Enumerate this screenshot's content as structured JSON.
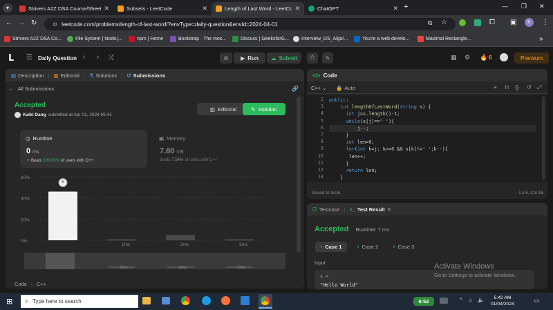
{
  "browser": {
    "tabs": [
      {
        "label": "Strivers A2Z DSA Course/Sheet",
        "active": false
      },
      {
        "label": "Subsets - LeetCode",
        "active": false
      },
      {
        "label": "Length of Last Word - LeetCode",
        "active": true
      },
      {
        "label": "ChatGPT",
        "active": false
      }
    ],
    "url": "leetcode.com/problems/length-of-last-word/?envType=daily-question&envId=2024-04-01",
    "profile_initial": "K",
    "bookmarks": [
      "Strivers A2Z DSA Co...",
      "File System | Node.j...",
      "npm | Home",
      "Bootstrap · The mos...",
      "Discuss | GeeksforG...",
      "Interview_DS_Algo/...",
      "You're a web develo...",
      "Maximal Rectangle..."
    ]
  },
  "header": {
    "title": "Daily Question",
    "run": "Run",
    "submit": "Submit",
    "streak": "6",
    "premium": "Premium"
  },
  "left": {
    "tabs": [
      "Description",
      "Editorial",
      "Solutions",
      "Submissions"
    ],
    "all_submissions": "All Submissions",
    "status": "Accepted",
    "user": "Kalki Dang",
    "submitted": "submitted at Apr 01, 2024 05:41",
    "editorial_btn": "Editorial",
    "solution_btn": "Solution",
    "runtime_label": "Runtime",
    "runtime_value": "0",
    "runtime_unit": "ms",
    "runtime_beats_pre": "Beats",
    "runtime_beats": "100.00%",
    "runtime_beats_post": "of users with C++",
    "memory_label": "Memory",
    "memory_value": "7.80",
    "memory_unit": "MB",
    "memory_beats_pre": "Beats",
    "memory_beats": "7.54%",
    "memory_beats_post": "of users with C++",
    "code_label": "Code",
    "lang": "C++"
  },
  "chart_data": {
    "type": "bar",
    "yticks": [
      "60%",
      "40%",
      "20%",
      "0%"
    ],
    "ylim": [
      0,
      60
    ],
    "categories": [
      "",
      "1ms",
      "2ms",
      "3ms"
    ],
    "values": [
      46,
      1,
      5,
      1
    ],
    "highlight_index": 0,
    "mini_labels": [
      "1ms",
      "2ms",
      "3ms"
    ]
  },
  "editor": {
    "title": "Code",
    "lang": "C++",
    "mode": "Auto",
    "lines": [
      {
        "n": "2",
        "text": "public:"
      },
      {
        "n": "3",
        "text": "    int lengthOfLastWord(string s) {"
      },
      {
        "n": "4",
        "text": "      int j=s.length()-1;"
      },
      {
        "n": "5",
        "text": "      while(s[j]==' '){"
      },
      {
        "n": "6",
        "text": "          j--;"
      },
      {
        "n": "7",
        "text": "      }"
      },
      {
        "n": "8",
        "text": "      int len=0;"
      },
      {
        "n": "9",
        "text": "      for(int k=j; k>=0 && s[k]!=' ';k--){"
      },
      {
        "n": "10",
        "text": "       len++;"
      },
      {
        "n": "11",
        "text": "      }"
      },
      {
        "n": "12",
        "text": "      return len;"
      },
      {
        "n": "13",
        "text": "    }"
      }
    ],
    "saved": "Saved to local",
    "cursor": "Ln 6, Col 16"
  },
  "test": {
    "tab_testcase": "Testcase",
    "tab_result": "Test Result",
    "status": "Accepted",
    "runtime": "Runtime: 7 ms",
    "cases": [
      "Case 1",
      "Case 2",
      "Case 3"
    ],
    "input_label": "Input",
    "var": "s =",
    "value": "\"Hello World\""
  },
  "watermark": {
    "line1": "Activate Windows",
    "line2": "Go to Settings to activate Windows."
  },
  "taskbar": {
    "search": "Type here to search",
    "time_widget": "6:52",
    "time": "5:42 AM",
    "date": "01/04/2024"
  }
}
